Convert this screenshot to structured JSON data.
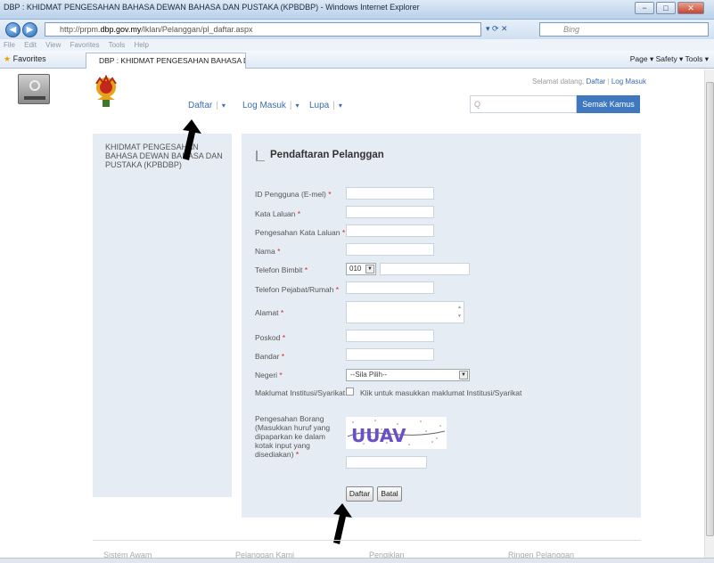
{
  "window": {
    "title": "DBP : KHIDMAT PENGESAHAN BAHASA DEWAN BAHASA DAN PUSTAKA (KPBDBP) - Windows Internet Explorer",
    "controls": [
      "−",
      "□",
      "✕"
    ]
  },
  "browser": {
    "url_prefix": "http://prpm.",
    "url_domain": "dbp.gov.my",
    "url_path": "/lklan/Pelanggan/pl_daftar.aspx",
    "search_placeholder": "Bing",
    "menu": [
      "File",
      "Edit",
      "View",
      "Favorites",
      "Tools",
      "Help"
    ],
    "favorites_label": "Favorites",
    "tab_title": "DBP : KHIDMAT PENGESAHAN BAHASA DEWAN ...",
    "tools": "Page ▾   Safety ▾   Tools ▾"
  },
  "site": {
    "welcome": "Selamat datang,",
    "welcome_links": [
      "Daftar",
      "Log Masuk"
    ],
    "nav": [
      "Daftar",
      "Log Masuk",
      "Lupa"
    ],
    "kamus_placeholder": "Q",
    "kamus_button": "Semak Kamus",
    "left_title": "KHIDMAT PENGESAHAN BAHASA DEWAN BAHASA DAN PUSTAKA (KPBDBP)"
  },
  "form": {
    "title": "Pendaftaran Pelanggan",
    "fields": [
      {
        "label": "ID Pengguna (E-mel)",
        "required": true
      },
      {
        "label": "Kata Laluan",
        "required": true
      },
      {
        "label": "Pengesahan Kata Laluan",
        "required": true
      },
      {
        "label": "Nama",
        "required": true
      },
      {
        "label": "Telefon Bimbit",
        "required": true
      },
      {
        "label": "Telefon Pejabat/Rumah",
        "required": true
      },
      {
        "label": "Alamat",
        "required": true
      },
      {
        "label": "Poskod",
        "required": true
      },
      {
        "label": "Bandar",
        "required": true
      },
      {
        "label": "Negeri",
        "required": true
      },
      {
        "label": "Maklumat Institusi/Syarikat",
        "required": false
      }
    ],
    "phone_prefix": "010",
    "negeri_select": "--Sila Pilih--",
    "checkbox_label": "Klik untuk masukkan maklumat Institusi/Syarikat",
    "captcha_label": "Pengesahan Borang (Masukkan huruf yang dipaparkan ke dalam kotak input yang disediakan)",
    "captcha_text": "UUAV",
    "submit_label": "Daftar",
    "cancel_label": "Batal",
    "required_mark": "*"
  },
  "footer": [
    "Sistem Awam",
    "Pelanggan Kami",
    "Pengiklan",
    "Ringen Pelanggan"
  ]
}
